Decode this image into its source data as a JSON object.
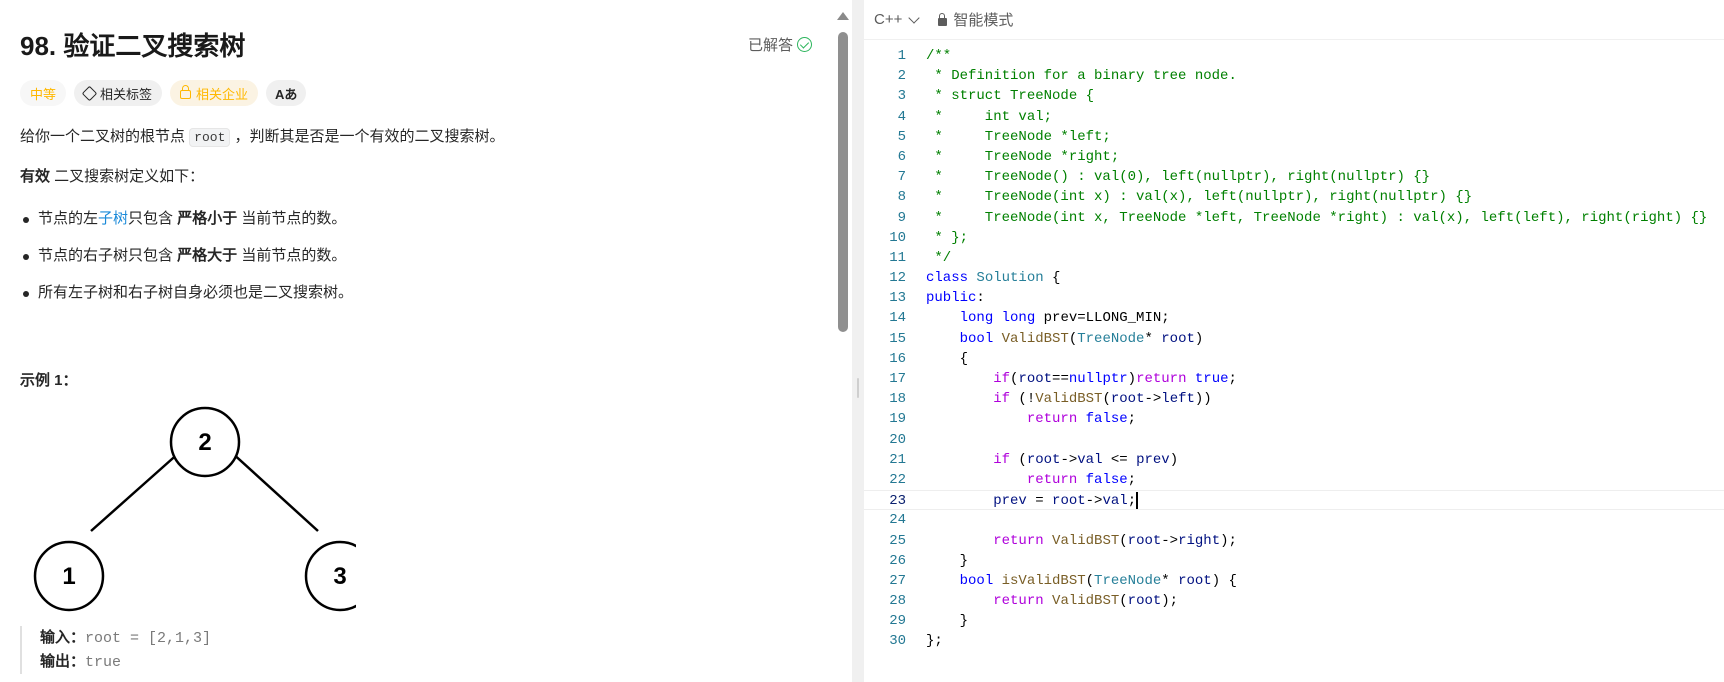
{
  "problem": {
    "title": "98. 验证二叉搜索树",
    "solved_label": "已解答",
    "tags": {
      "difficulty": "中等",
      "topics": "相关标签",
      "companies": "相关企业",
      "font": "Aあ"
    },
    "desc_before": "给你一个二叉树的根节点 ",
    "desc_code": "root",
    "desc_after": " ，判断其是否是一个有效的二叉搜索树。",
    "valid_bold": "有效",
    "valid_rest": " 二叉搜索树定义如下：",
    "rules": [
      {
        "a": "节点的左",
        "link": "子树",
        "b": "只包含 ",
        "bold": "严格小于",
        "c": " 当前节点的数。"
      },
      {
        "a": "节点的右子树只包含 ",
        "link": "",
        "b": "",
        "bold": "严格大于",
        "c": " 当前节点的数。"
      },
      {
        "a": "所有左子树和右子树自身必须也是二叉搜索树。",
        "link": "",
        "b": "",
        "bold": "",
        "c": ""
      }
    ],
    "example_title": "示例 1：",
    "tree_nodes": [
      "2",
      "1",
      "3"
    ],
    "input_label": "输入：",
    "input_value": "root = [2,1,3]",
    "output_label": "输出：",
    "output_value": "true"
  },
  "editor": {
    "language": "C++",
    "mode": "智能模式",
    "active_line": 23
  }
}
